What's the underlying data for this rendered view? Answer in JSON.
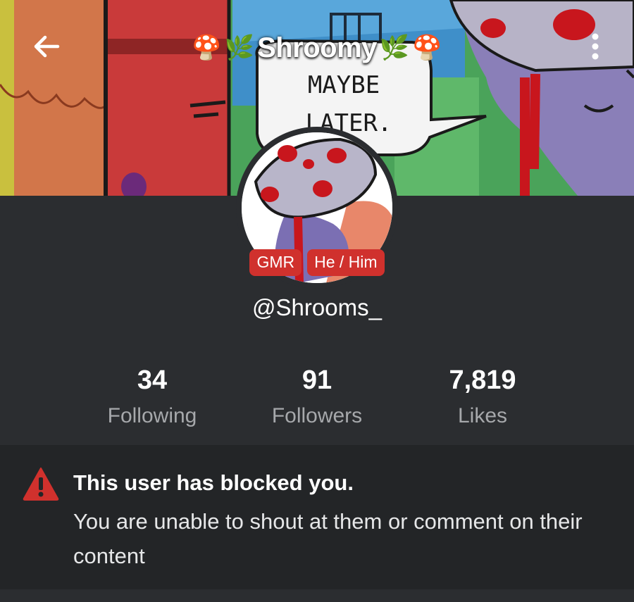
{
  "header": {
    "title": "Shroomy",
    "title_deco": [
      "🍄",
      "🌿",
      "🌿",
      "🍄"
    ],
    "back_icon": "arrow-left-icon",
    "menu_icon": "more-vertical-icon"
  },
  "banner": {
    "speech_bubble_text": "MAYBE LATER."
  },
  "profile": {
    "tags": [
      "GMR",
      "He / Him"
    ],
    "handle": "@Shrooms_"
  },
  "stats": [
    {
      "value": "34",
      "label": "Following"
    },
    {
      "value": "91",
      "label": "Followers"
    },
    {
      "value": "7,819",
      "label": "Likes"
    }
  ],
  "notice": {
    "icon": "warning-icon",
    "title": "This user has blocked you.",
    "body": "You are unable to shout at them or comment on their content"
  },
  "colors": {
    "background": "#2b2d30",
    "notice_background": "#232527",
    "tag_red": "#d0312d",
    "label_gray": "#a6a8ab"
  }
}
